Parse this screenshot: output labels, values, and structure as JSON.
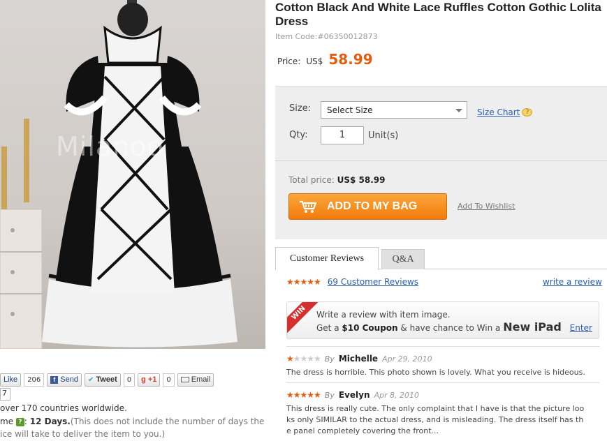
{
  "image": {
    "watermark": "Milanoo"
  },
  "share": {
    "like_label": "Like",
    "like_count": "206",
    "send_label": "Send",
    "tweet_label": "Tweet",
    "tweet_count": "0",
    "gplus_label": "+1",
    "gplus_count": "0",
    "email_label": "Email",
    "below_value": "7"
  },
  "shipping": {
    "line1": "over 170 countries worldwide.",
    "line2_prefix": "me",
    "line2_days": "12 Days.",
    "line2_note": "(This does not include the number of days the",
    "line3": "ice will take to deliver the item to you.)"
  },
  "product": {
    "title": "Cotton Black And White Lace Ruffles Cotton Gothic Lolita Dress",
    "item_code": "Item Code:#06350012873",
    "price_label": "Price:",
    "currency": "US$",
    "price": "58.99"
  },
  "options": {
    "size_label": "Size:",
    "size_value": "Select Size",
    "size_chart": "Size Chart",
    "qty_label": "Qty:",
    "qty_value": "1",
    "unit_label": "Unit(s)",
    "total_label": "Total price:",
    "total_value": "US$ 58.99",
    "add_button": "ADD TO MY BAG",
    "wishlist": "Add To Wishlist"
  },
  "tabs": [
    {
      "label": "Customer Reviews"
    },
    {
      "label": "Q&A"
    }
  ],
  "reviews_header": {
    "rating": 5,
    "count_link": "69 Customer Reviews",
    "write_link": "write a review"
  },
  "promo": {
    "ribbon": "WIN",
    "line1": "Write a review with  item image.",
    "line2_a": "Get a",
    "coupon": "$10 Coupon",
    "line2_b": "& have chance to Win a",
    "ipad": "New iPad",
    "enter": "Enter"
  },
  "reviews": [
    {
      "rating": 1,
      "by": "By",
      "name": "Michelle",
      "date": "Apr 29, 2010",
      "text": "The dress is horrible. This photo shown is lovely. What you receive is hideous."
    },
    {
      "rating": 5,
      "by": "By",
      "name": "Evelyn",
      "date": "Apr 8, 2010",
      "text_lines": [
        "This dress is really cute. The only complaint that I have is that the picture loo",
        "ks only SIMILAR to the actual dress, and is misleading. The dress itself has th",
        "e panel completely covering the front..."
      ]
    }
  ],
  "colors": {
    "accent": "#e25d0e",
    "link": "#2a5db0",
    "button": "#f07c0c"
  }
}
